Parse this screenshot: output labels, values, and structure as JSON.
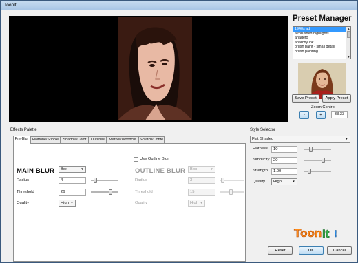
{
  "window": {
    "title": "ToonIt"
  },
  "preset_manager": {
    "title": "Preset Manager",
    "presets": [
      "1940s ad",
      "airbrushed highlights",
      "anadeto",
      "anarchy ink",
      "brush paint - small detail",
      "brush painting"
    ],
    "selected": "1940s ad",
    "save_label": "Save Preset",
    "apply_label": "Apply Preset"
  },
  "zoom": {
    "label": "Zoom Control",
    "minus": "-",
    "plus": "+",
    "value": "33.33"
  },
  "effects": {
    "label": "Effects Palette",
    "tabs": [
      "Pre-Blur",
      "Halftone/Stipple",
      "Shadow/Color",
      "Outlines",
      "Marker/Woodcut",
      "Scratch/Conte"
    ],
    "active_tab": "Pre-Blur",
    "use_outline_blur": "Use Outline Blur",
    "main_blur": {
      "heading": "MAIN BLUR",
      "type": "Box",
      "radius_label": "Radius",
      "radius": "4",
      "threshold_label": "Threshold",
      "threshold": "26",
      "quality_label": "Quality",
      "quality": "High"
    },
    "outline_blur": {
      "heading": "OUTLINE BLUR",
      "type": "Box",
      "radius_label": "Radius",
      "radius": "3",
      "threshold_label": "Threshold",
      "threshold": "15",
      "quality_label": "Quality",
      "quality": "High"
    }
  },
  "style": {
    "label": "Style Selector",
    "selected": "Flat Shaded",
    "flatness_label": "Flatness",
    "flatness": "10",
    "simplicity_label": "Simplicity",
    "simplicity": "20",
    "strength_label": "Strength",
    "strength": "1.00",
    "quality_label": "Quality",
    "quality": "High"
  },
  "footer": {
    "reset": "Reset",
    "ok": "OK",
    "cancel": "Cancel"
  },
  "logo": {
    "text": "ToonIt!"
  },
  "colors": {
    "accent": "#3399ff",
    "preview_bg": "#000000"
  }
}
